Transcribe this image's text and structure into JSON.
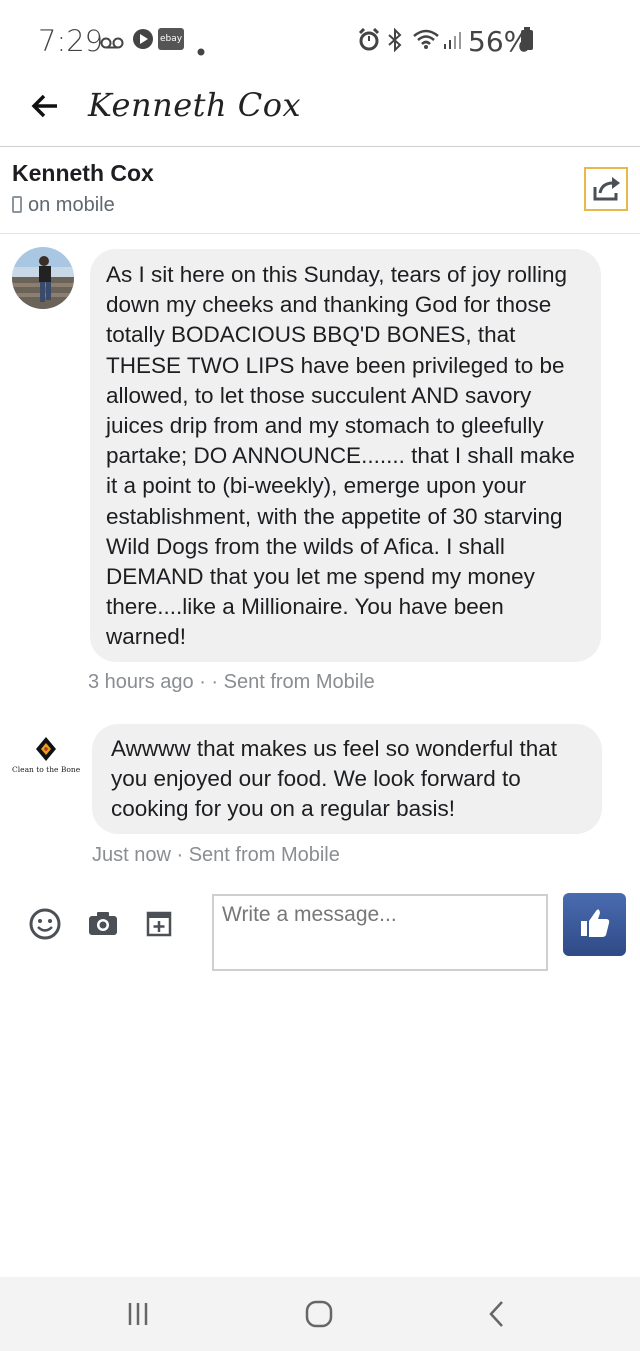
{
  "status_bar": {
    "time": "7:29",
    "ebay_label": "ebay",
    "battery": "56%"
  },
  "app_bar": {
    "title": "Kenneth Cox"
  },
  "profile": {
    "name": "Kenneth Cox",
    "presence": "on mobile"
  },
  "messages": [
    {
      "text": "As I sit here on this Sunday, tears of joy rolling down my cheeks and thanking God for those totally BODACIOUS BBQ'D BONES, that THESE TWO LIPS have been privileged to be allowed, to let those succulent AND savory juices drip from and my stomach to gleefully partake; DO ANNOUNCE....... that I shall make it a point to (bi-weekly), emerge upon your establishment,  with the appetite of 30 starving Wild Dogs from the wilds of Afica. I shall DEMAND that you let me spend my money there....like a Millionaire. You have been warned!",
      "meta": "3 hours ago · · Sent from Mobile"
    },
    {
      "sender_logo_text": "Clean to the Bone",
      "text": "Awwww that makes us feel so wonderful that you enjoyed our food. We look forward to cooking for you on a regular basis!",
      "meta": "Just now · Sent from Mobile"
    }
  ],
  "composer": {
    "placeholder": "Write a message..."
  },
  "icons": {
    "back": "arrow-left-icon",
    "share": "share-icon",
    "emoji": "smiley-icon",
    "camera": "camera-icon",
    "sticker": "add-sticker-icon",
    "like": "thumbs-up-icon"
  },
  "colors": {
    "like_button": "#3b5998",
    "bubble": "#f0f0f0",
    "share_border": "#e8b84a"
  }
}
